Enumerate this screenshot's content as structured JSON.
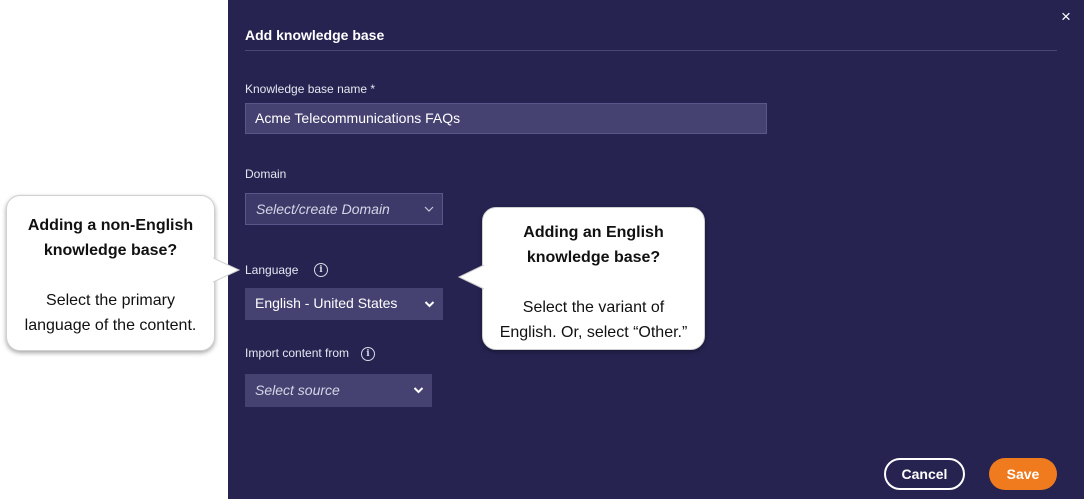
{
  "dialog": {
    "title": "Add knowledge base",
    "close_label": "×"
  },
  "fields": {
    "name_label": "Knowledge base name *",
    "name_value": "Acme Telecommunications FAQs",
    "domain_label": "Domain",
    "domain_placeholder": "Select/create Domain",
    "language_label": "Language",
    "language_value": "English - United States",
    "import_label": "Import content from",
    "import_placeholder": "Select source"
  },
  "buttons": {
    "cancel": "Cancel",
    "save": "Save"
  },
  "callouts": {
    "left": {
      "title_line1": "Adding a non-English",
      "title_line2": "knowledge base?",
      "body_line1": "Select the primary",
      "body_line2": "language of the content."
    },
    "right": {
      "title_line1": "Adding an English",
      "title_line2": "knowledge base?",
      "body_line1": "Select the variant of",
      "body_line2": "English. Or, select “Other.”"
    }
  },
  "colors": {
    "panel_bg": "#262351",
    "field_bg": "#454272",
    "save_accent": "#f07b1f"
  }
}
